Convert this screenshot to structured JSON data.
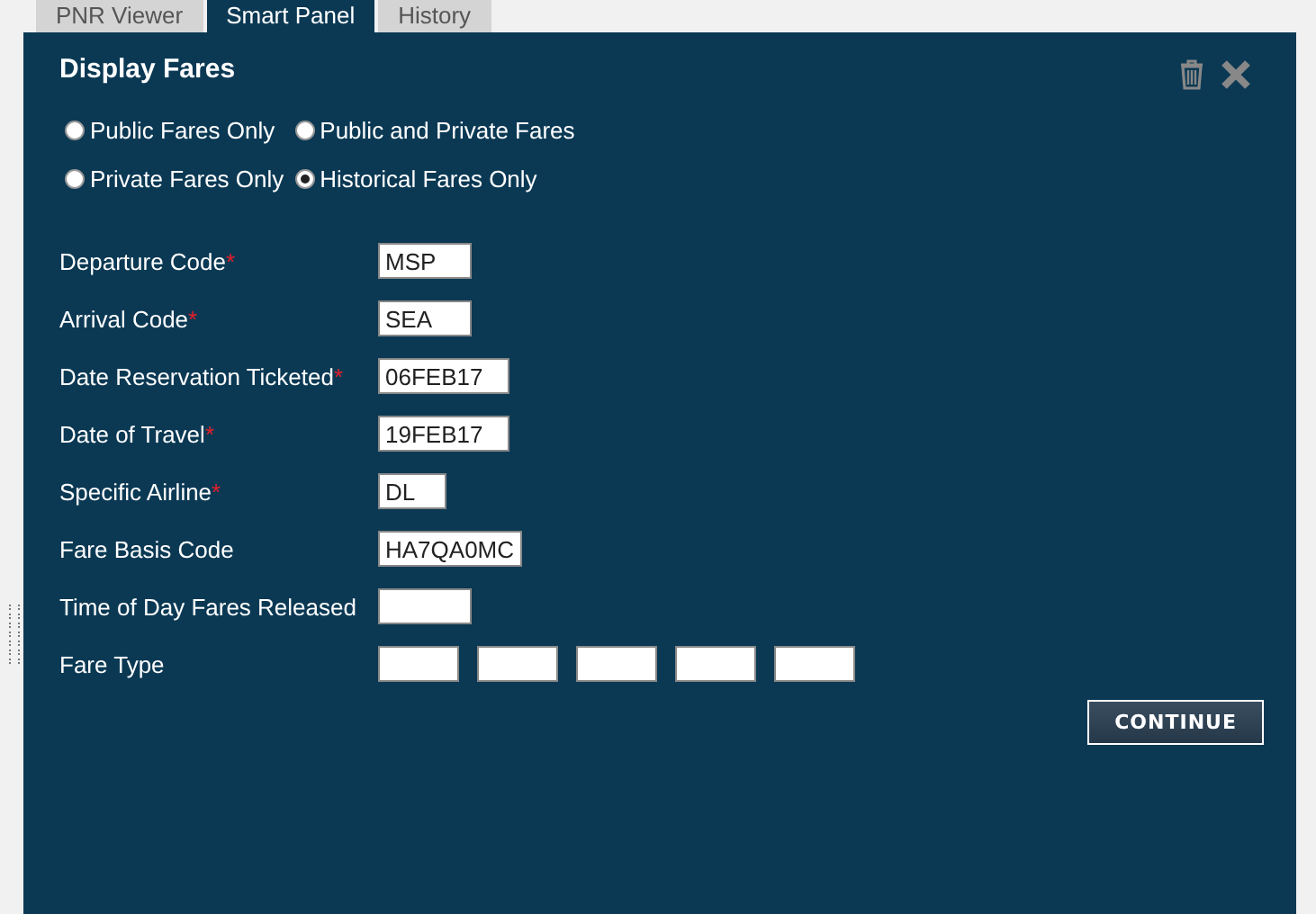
{
  "tabs": [
    {
      "label": "PNR Viewer",
      "selected": false
    },
    {
      "label": "Smart Panel",
      "selected": true
    },
    {
      "label": "History",
      "selected": false
    }
  ],
  "panel": {
    "title": "Display Fares",
    "fare_options": [
      {
        "label": "Public Fares Only",
        "selected": false
      },
      {
        "label": "Public and Private Fares",
        "selected": false
      },
      {
        "label": "Private Fares Only",
        "selected": false
      },
      {
        "label": "Historical Fares Only",
        "selected": true
      }
    ],
    "fields": [
      {
        "label": "Departure Code",
        "required_mark": "*",
        "value": "MSP"
      },
      {
        "label": "Arrival Code",
        "required_mark": "*",
        "value": "SEA"
      },
      {
        "label": "Date Reservation Ticketed",
        "required_mark": "*",
        "value": "06FEB17"
      },
      {
        "label": "Date of Travel",
        "required_mark": "*",
        "value": "19FEB17"
      },
      {
        "label": "Specific Airline",
        "required_mark": "*",
        "value": "DL"
      },
      {
        "label": "Fare Basis Code",
        "value": "HA7QA0MC"
      },
      {
        "label": "Time of Day Fares Released"
      }
    ],
    "fare_type": {
      "label": "Fare Type"
    },
    "continue_button": "CONTINUE"
  }
}
